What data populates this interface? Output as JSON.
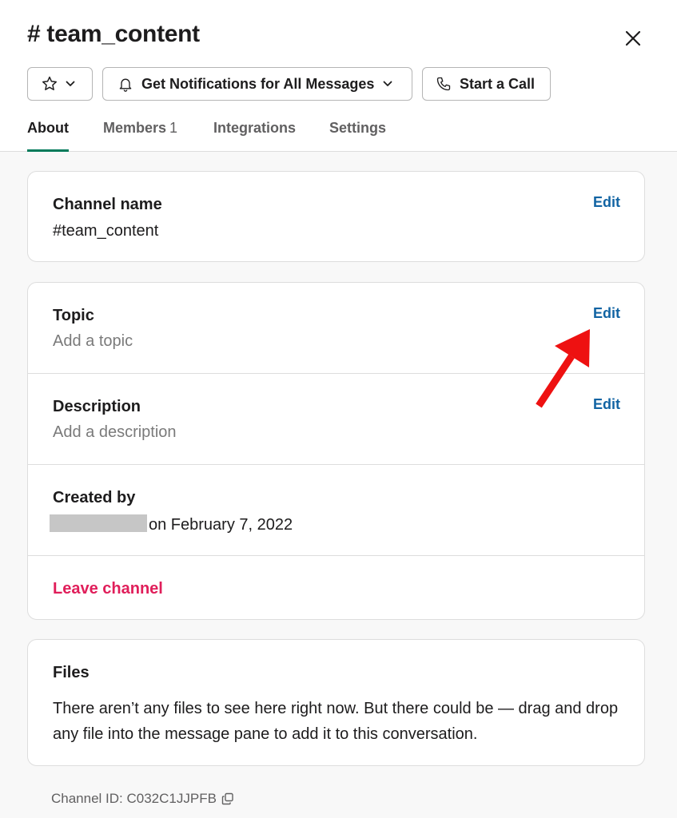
{
  "header": {
    "title": "# team_content",
    "close_icon": "close-icon",
    "buttons": {
      "star_icon": "star-icon",
      "chevron_icon": "chevron-down-icon",
      "notifications_label": "Get Notifications for All Messages",
      "bell_icon": "bell-icon",
      "call_label": "Start a Call",
      "phone_icon": "phone-icon"
    }
  },
  "tabs": {
    "about": "About",
    "members": "Members",
    "members_count": "1",
    "integrations": "Integrations",
    "settings": "Settings",
    "active": "About"
  },
  "channel_name": {
    "label": "Channel name",
    "value": "#team_content",
    "edit": "Edit"
  },
  "topic": {
    "label": "Topic",
    "placeholder": "Add a topic",
    "edit": "Edit"
  },
  "description": {
    "label": "Description",
    "placeholder": "Add a description",
    "edit": "Edit"
  },
  "created_by": {
    "label": "Created by",
    "date_text": "on February 7, 2022"
  },
  "leave": {
    "label": "Leave channel"
  },
  "files": {
    "label": "Files",
    "text": "There aren’t any files to see here right now. But there could be — drag and drop any file into the message pane to add it to this conversation."
  },
  "footer": {
    "channel_id": "Channel ID: C032C1JJPFB",
    "copy_icon": "copy-icon"
  },
  "colors": {
    "link": "#1264a3",
    "danger": "#e01e5a",
    "tab_underline": "#007a5a",
    "annotation_arrow": "#ee1111"
  }
}
